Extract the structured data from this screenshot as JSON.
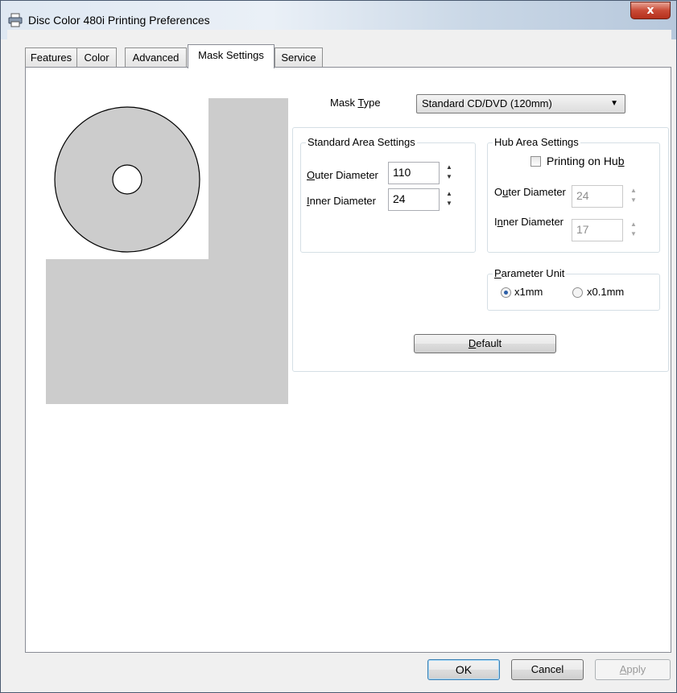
{
  "window": {
    "title": "Disc Color 480i Printing Preferences",
    "close_label": "x"
  },
  "tabs": [
    {
      "label": "Features"
    },
    {
      "label": "Color"
    },
    {
      "label": "Advanced"
    },
    {
      "label": "Mask Settings"
    },
    {
      "label": "Service"
    }
  ],
  "active_tab": "Mask Settings",
  "mask_type": {
    "label_pre": "Mask ",
    "label_key": "T",
    "label_post": "ype",
    "value": "Standard CD/DVD (120mm)"
  },
  "standard_area": {
    "title": "Standard Area Settings",
    "outer": {
      "label_key": "O",
      "label_rest": "uter Diameter",
      "value": "110"
    },
    "inner": {
      "label_key": "I",
      "label_rest": "nner Diameter",
      "value": "24"
    }
  },
  "hub_area": {
    "title": "Hub Area Settings",
    "printing_on_hub": {
      "label_pre": "Printing on Hu",
      "label_key": "b",
      "checked": false
    },
    "outer": {
      "label_pre": "O",
      "label_key": "u",
      "label_rest": "ter Diameter",
      "value": "24"
    },
    "inner": {
      "label_pre": "I",
      "label_key": "n",
      "label_rest": "ner Diameter",
      "value": "17"
    }
  },
  "parameter_unit": {
    "title_key": "P",
    "title_rest": "arameter Unit",
    "options": [
      {
        "label": "x1mm",
        "selected": true
      },
      {
        "label": "x0.1mm",
        "selected": false
      }
    ]
  },
  "default_button": {
    "key": "D",
    "rest": "efault"
  },
  "footer": {
    "ok": "OK",
    "cancel": "Cancel",
    "apply_key": "A",
    "apply_rest": "pply"
  },
  "colors": {
    "preview_grey": "#cccccc",
    "disc_fill": "#cccccc",
    "accent": "#3c7fb1"
  }
}
